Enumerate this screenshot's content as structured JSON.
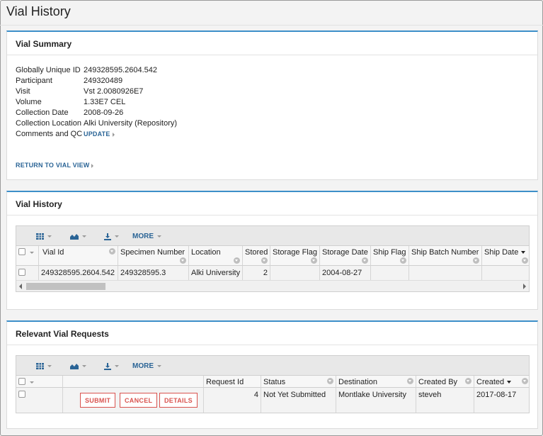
{
  "page": {
    "title": "Vial History"
  },
  "vial_summary": {
    "title": "Vial Summary",
    "fields": [
      {
        "label": "Globally Unique ID",
        "value": "249328595.2604.542"
      },
      {
        "label": "Participant",
        "value": "249320489"
      },
      {
        "label": "Visit",
        "value": "Vst 2.0080926E7"
      },
      {
        "label": "Volume",
        "value": "1.33E7 CEL"
      },
      {
        "label": "Collection Date",
        "value": "2008-09-26"
      },
      {
        "label": "Collection Location",
        "value": "Alki University (Repository)"
      },
      {
        "label": "Comments and QC",
        "value": "UPDATE"
      }
    ],
    "return_link": "RETURN TO VIAL VIEW"
  },
  "vial_history": {
    "title": "Vial History",
    "toolbar": {
      "more_label": "MORE"
    },
    "columns": [
      "Vial Id",
      "Specimen Number",
      "Location",
      "Stored",
      "Storage Flag",
      "Storage Date",
      "Ship Flag",
      "Ship Batch Number",
      "Ship Date"
    ],
    "rows": [
      [
        "249328595.2604.542",
        "249328595.3",
        "Alki University",
        "2",
        "",
        "2004-08-27",
        "",
        "",
        ""
      ]
    ]
  },
  "vial_requests": {
    "title": "Relevant Vial Requests",
    "toolbar": {
      "more_label": "MORE"
    },
    "columns": [
      "Request Id",
      "Status",
      "Destination",
      "Created By",
      "Created"
    ],
    "rows": [
      [
        "4",
        "Not Yet Submitted",
        "Montlake University",
        "steveh",
        "2017-08-17"
      ]
    ],
    "actions": {
      "submit": "SUBMIT",
      "cancel": "CANCEL",
      "details": "DETAILS"
    }
  },
  "colors": {
    "accent": "#3d8fc9",
    "link": "#2a6496",
    "danger": "#d9534f"
  }
}
